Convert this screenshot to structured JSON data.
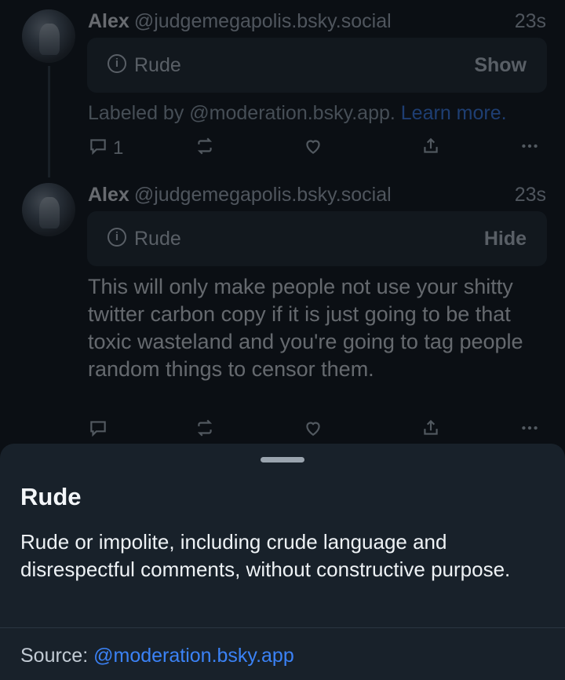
{
  "posts": [
    {
      "author_name": "Alex",
      "author_handle": "@judgemegapolis.bsky.social",
      "time": "23s",
      "label": "Rude",
      "label_action": "Show",
      "labeled_by": "Labeled by @moderation.bsky.app.",
      "learn_more": "Learn more.",
      "reply_count": "1"
    },
    {
      "author_name": "Alex",
      "author_handle": "@judgemegapolis.bsky.social",
      "time": "23s",
      "label": "Rude",
      "label_action": "Hide",
      "text": "This will only make people not use your shitty twitter carbon copy if it is just going to be that toxic wasteland and you're going to tag people random things to censor them."
    }
  ],
  "sheet": {
    "title": "Rude",
    "description": "Rude or impolite, including crude language and disrespectful comments, without constructive purpose.",
    "source_label": "Source:",
    "source_link": "@moderation.bsky.app"
  },
  "icons": [
    "info-icon",
    "reply-icon",
    "repost-icon",
    "like-icon",
    "share-icon",
    "more-icon"
  ],
  "colors": {
    "background": "#0b0f14",
    "sheet": "#18212a",
    "link": "#3b82f6"
  }
}
